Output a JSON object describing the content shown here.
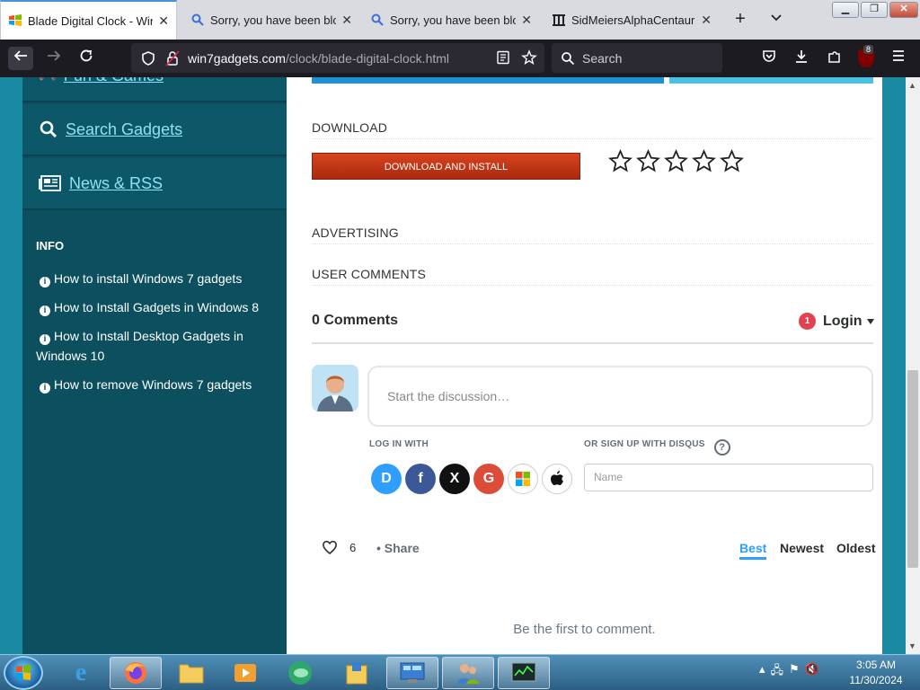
{
  "browser": {
    "tabs": [
      {
        "title": "Blade Digital Clock - Wind",
        "favicon": "windows-logo-icon",
        "active": true
      },
      {
        "title": "Sorry, you have been block",
        "favicon": "search-icon",
        "active": false
      },
      {
        "title": "Sorry, you have been block",
        "favicon": "search-icon",
        "active": false
      },
      {
        "title": "SidMeiersAlphaCentauriUS",
        "favicon": "archive-icon",
        "active": false
      }
    ],
    "new_tab": "+",
    "tab_list": "⌄",
    "url_host": "win7gadgets.com",
    "url_path": "/clock/blade-digital-clock.html",
    "search_placeholder": "Search",
    "ublock_badge": "8"
  },
  "sidebar": {
    "nav": [
      {
        "label": "Fun & Games",
        "icon": "gamepad-icon"
      },
      {
        "label": "Search Gadgets",
        "icon": "search-icon"
      },
      {
        "label": "News & RSS",
        "icon": "newspaper-icon"
      }
    ],
    "info_heading": "INFO",
    "info_items": [
      "How to install Windows 7 gadgets",
      "How to Install Gadgets in Windows 8",
      "How to Install Desktop Gadgets in Windows 10",
      "How to remove Windows 7 gadgets"
    ]
  },
  "main": {
    "download_heading": "DOWNLOAD",
    "download_button": "DOWNLOAD AND INSTALL",
    "rating_stars": 5,
    "rating_filled": 0,
    "advertising_heading": "ADVERTISING",
    "comments_heading": "USER COMMENTS"
  },
  "disqus": {
    "count_label": "0 Comments",
    "notification_count": "1",
    "login_label": "Login",
    "placeholder": "Start the discussion…",
    "log_in_with": "LOG IN WITH",
    "sign_up_with": "OR SIGN UP WITH DISQUS",
    "help": "?",
    "name_placeholder": "Name",
    "social": [
      {
        "name": "disqus",
        "glyph": "D",
        "color": "#2e9fff"
      },
      {
        "name": "facebook",
        "glyph": "f",
        "color": "#3b5998"
      },
      {
        "name": "x",
        "glyph": "X",
        "color": "#111111"
      },
      {
        "name": "google",
        "glyph": "G",
        "color": "#dd4b39"
      },
      {
        "name": "microsoft",
        "glyph": "",
        "color": "#ffffff"
      },
      {
        "name": "apple",
        "glyph": "",
        "color": "#ffffff"
      }
    ],
    "likes": "6",
    "share_label": "Share",
    "sort_options": [
      "Best",
      "Newest",
      "Oldest"
    ],
    "sort_active": "Best",
    "empty_message": "Be the first to comment."
  },
  "taskbar": {
    "clock_time": "3:05 AM",
    "clock_date": "11/30/2024"
  }
}
